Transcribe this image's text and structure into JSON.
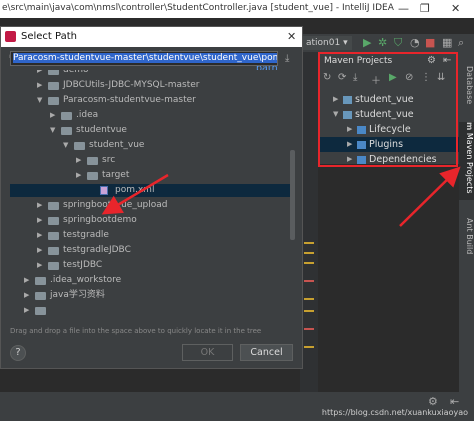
{
  "window": {
    "title": "e\\src\\main\\java\\com\\nmsl\\controller\\StudentController.java [student_vue] - IntelliJ IDEA"
  },
  "toolbar": {
    "run_config": "ation01 ▾"
  },
  "dialog": {
    "title": "Select Path",
    "hide_path": "Hide path",
    "path_value": "Paracosm-studentvue-master\\studentvue\\student_vue\\pom.xml",
    "hint": "Drag and drop a file into the space above to quickly locate it in the tree",
    "ok": "OK",
    "cancel": "Cancel",
    "help": "?",
    "tree": [
      {
        "label": "demo",
        "depth": 1,
        "expanded": false,
        "kind": "folder"
      },
      {
        "label": "JDBCUtils-JDBC-MYSQL-master",
        "depth": 1,
        "expanded": false,
        "kind": "folder"
      },
      {
        "label": "Paracosm-studentvue-master",
        "depth": 1,
        "expanded": true,
        "kind": "folder"
      },
      {
        "label": ".idea",
        "depth": 2,
        "expanded": false,
        "kind": "folder"
      },
      {
        "label": "studentvue",
        "depth": 2,
        "expanded": true,
        "kind": "folder"
      },
      {
        "label": "student_vue",
        "depth": 3,
        "expanded": true,
        "kind": "folder"
      },
      {
        "label": "src",
        "depth": 4,
        "expanded": false,
        "kind": "folder"
      },
      {
        "label": "target",
        "depth": 4,
        "expanded": false,
        "kind": "folder"
      },
      {
        "label": "pom.xml",
        "depth": 5,
        "expanded": false,
        "kind": "file",
        "selected": true
      },
      {
        "label": "springboot_vue_upload",
        "depth": 1,
        "expanded": false,
        "kind": "folder"
      },
      {
        "label": "springbootdemo",
        "depth": 1,
        "expanded": false,
        "kind": "folder"
      },
      {
        "label": "testgradle",
        "depth": 1,
        "expanded": false,
        "kind": "folder"
      },
      {
        "label": "testgradleJDBC",
        "depth": 1,
        "expanded": false,
        "kind": "folder"
      },
      {
        "label": "testJDBC",
        "depth": 1,
        "expanded": false,
        "kind": "folder"
      },
      {
        "label": ".idea_workstore",
        "depth": 0,
        "expanded": false,
        "kind": "folder"
      },
      {
        "label": "java学习资料",
        "depth": 0,
        "expanded": false,
        "kind": "folder"
      },
      {
        "label": "",
        "depth": 0,
        "expanded": false,
        "kind": "folder"
      }
    ]
  },
  "maven": {
    "title": "Maven Projects",
    "rows": [
      {
        "label": "student_vue",
        "depth": 0,
        "expanded": false
      },
      {
        "label": "student_vue",
        "depth": 0,
        "expanded": true
      },
      {
        "label": "Lifecycle",
        "depth": 1,
        "expanded": false
      },
      {
        "label": "Plugins",
        "depth": 1,
        "expanded": false,
        "selected": true
      },
      {
        "label": "Dependencies",
        "depth": 1,
        "expanded": false
      }
    ]
  },
  "side_tabs": {
    "database": "Database",
    "maven": "Maven Projects",
    "ant": "Ant Build",
    "maven_letter": "m"
  },
  "watermark": "https://blog.csdn.net/xuankuxiaoyao",
  "colors": {
    "accent_red": "#e8252b",
    "selection": "#0d293e",
    "link": "#589df6"
  }
}
